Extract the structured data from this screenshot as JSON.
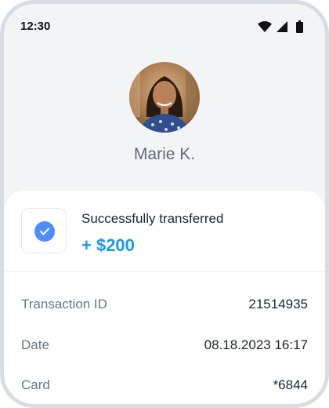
{
  "status_bar": {
    "time": "12:30",
    "icons": [
      "wifi-icon",
      "cellular-signal-icon",
      "battery-icon"
    ]
  },
  "recipient": {
    "name": "Marie K."
  },
  "transfer": {
    "status_text": "Successfully transferred",
    "amount": "+ $200",
    "accent_color": "#1a9be8",
    "check_color": "#4f8cff"
  },
  "details": [
    {
      "label": "Transaction ID",
      "value": "21514935"
    },
    {
      "label": "Date",
      "value": "08.18.2023 16:17"
    },
    {
      "label": "Card",
      "value": "*6844"
    }
  ]
}
